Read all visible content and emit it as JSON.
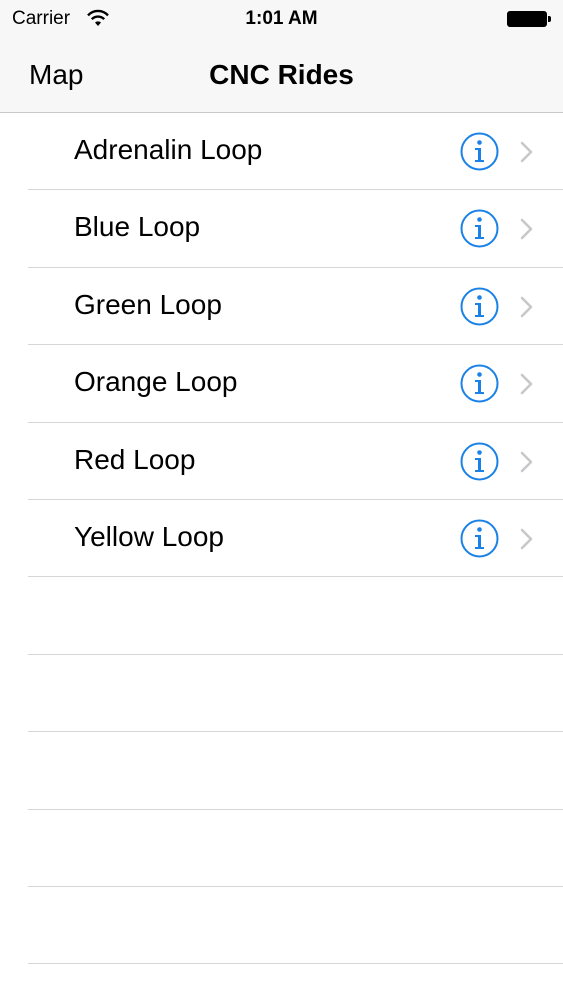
{
  "status_bar": {
    "carrier": "Carrier",
    "time": "1:01 AM",
    "wifi_icon": "wifi-icon",
    "battery_icon": "battery-icon",
    "battery_level": 1.0
  },
  "nav_bar": {
    "left_button": "Map",
    "title": "CNC Rides"
  },
  "rides": [
    {
      "label": "Adrenalin Loop"
    },
    {
      "label": "Blue Loop"
    },
    {
      "label": "Green Loop"
    },
    {
      "label": "Orange Loop"
    },
    {
      "label": "Red Loop"
    },
    {
      "label": "Yellow Loop"
    }
  ],
  "empty_rows": 5,
  "icons": {
    "detail": "info-icon",
    "disclosure": "chevron-right-icon"
  },
  "colors": {
    "accent": "#1a82e6",
    "chevron": "#c7c7cc",
    "separator": "#d6d6da",
    "bar_background": "#f7f7f8"
  }
}
